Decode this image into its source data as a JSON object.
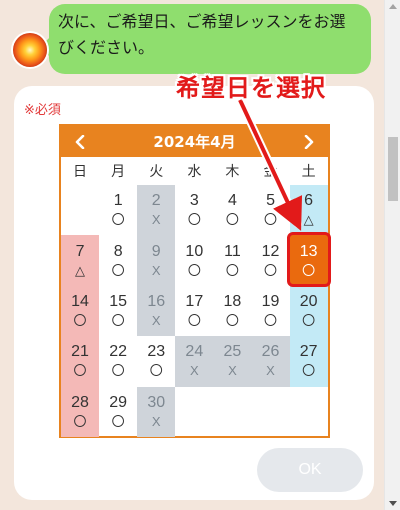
{
  "chat": {
    "message": "次に、ご希望日、ご希望レッスンをお選びください。"
  },
  "form": {
    "required_label": "※必須",
    "ok_label": "OK"
  },
  "annotation": {
    "label": "希望日を選択",
    "color": "#e21a1a"
  },
  "calendar": {
    "month_label": "2024年4月",
    "prev_label": "‹",
    "next_label": "›",
    "accent_color": "#e8831f",
    "weekdays": [
      "日",
      "月",
      "火",
      "水",
      "木",
      "金",
      "土"
    ],
    "selected_day": 13,
    "weeks": [
      [
        null,
        {
          "d": "1",
          "m": "〇",
          "t": "normal"
        },
        {
          "d": "2",
          "m": "X",
          "t": "closed"
        },
        {
          "d": "3",
          "m": "〇",
          "t": "normal"
        },
        {
          "d": "4",
          "m": "〇",
          "t": "normal"
        },
        {
          "d": "5",
          "m": "〇",
          "t": "normal"
        },
        {
          "d": "6",
          "m": "△",
          "t": "sat"
        }
      ],
      [
        {
          "d": "7",
          "m": "△",
          "t": "sun"
        },
        {
          "d": "8",
          "m": "〇",
          "t": "normal"
        },
        {
          "d": "9",
          "m": "X",
          "t": "closed"
        },
        {
          "d": "10",
          "m": "〇",
          "t": "normal"
        },
        {
          "d": "11",
          "m": "〇",
          "t": "normal"
        },
        {
          "d": "12",
          "m": "〇",
          "t": "normal"
        },
        {
          "d": "13",
          "m": "〇",
          "t": "selected"
        }
      ],
      [
        {
          "d": "14",
          "m": "〇",
          "t": "sun"
        },
        {
          "d": "15",
          "m": "〇",
          "t": "normal"
        },
        {
          "d": "16",
          "m": "X",
          "t": "closed"
        },
        {
          "d": "17",
          "m": "〇",
          "t": "normal"
        },
        {
          "d": "18",
          "m": "〇",
          "t": "normal"
        },
        {
          "d": "19",
          "m": "〇",
          "t": "normal"
        },
        {
          "d": "20",
          "m": "〇",
          "t": "sat"
        }
      ],
      [
        {
          "d": "21",
          "m": "〇",
          "t": "sun"
        },
        {
          "d": "22",
          "m": "〇",
          "t": "normal"
        },
        {
          "d": "23",
          "m": "〇",
          "t": "normal"
        },
        {
          "d": "24",
          "m": "X",
          "t": "closed"
        },
        {
          "d": "25",
          "m": "X",
          "t": "closed"
        },
        {
          "d": "26",
          "m": "X",
          "t": "closed"
        },
        {
          "d": "27",
          "m": "〇",
          "t": "sat"
        }
      ],
      [
        {
          "d": "28",
          "m": "〇",
          "t": "sun"
        },
        {
          "d": "29",
          "m": "〇",
          "t": "normal"
        },
        {
          "d": "30",
          "m": "X",
          "t": "closed"
        },
        null,
        null,
        null,
        null
      ]
    ]
  }
}
